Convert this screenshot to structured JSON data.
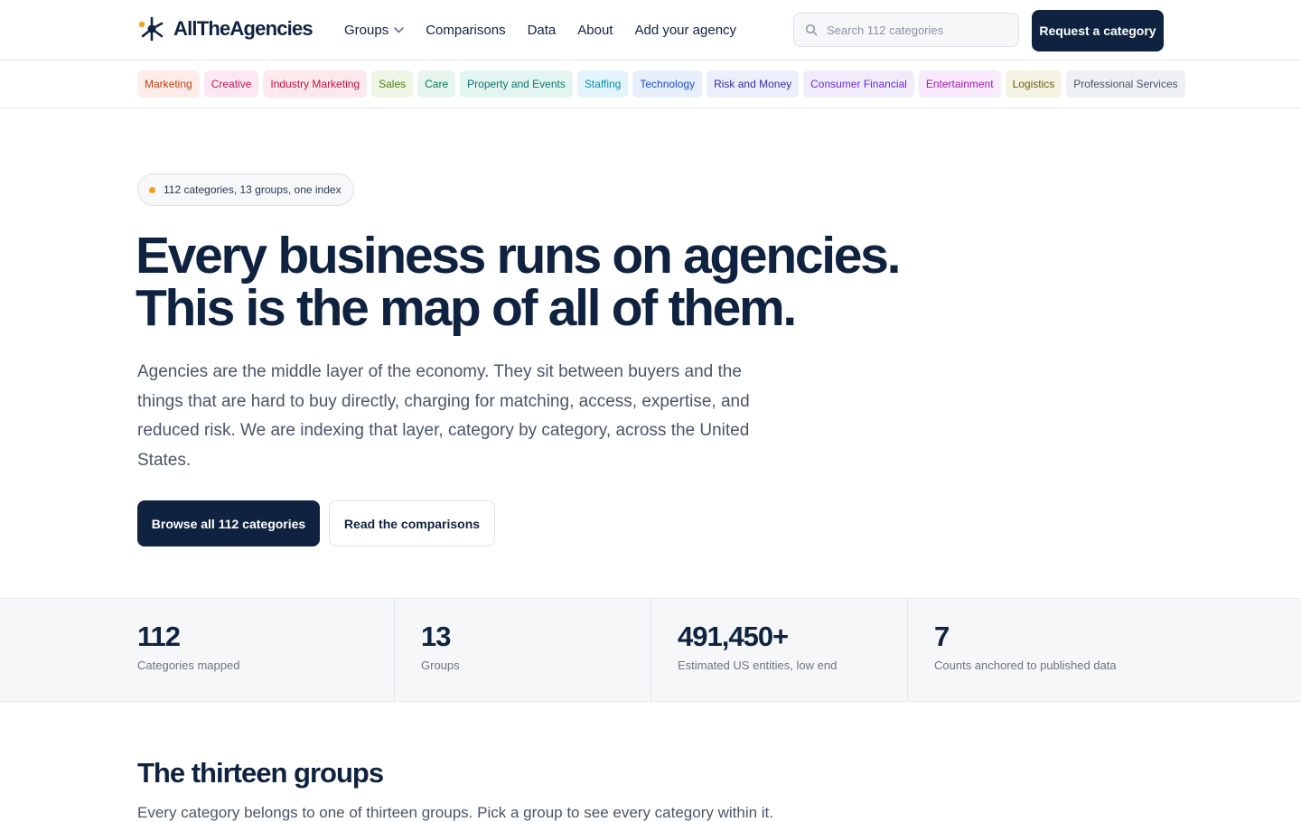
{
  "header": {
    "brand": "AllTheAgencies",
    "nav": [
      {
        "label": "Groups",
        "has_dropdown": true
      },
      {
        "label": "Comparisons"
      },
      {
        "label": "Data"
      },
      {
        "label": "About"
      },
      {
        "label": "Add your agency"
      }
    ],
    "search": {
      "placeholder": "Search 112 categories",
      "value": ""
    },
    "request_button": "Request a category"
  },
  "chips": [
    {
      "label": "Marketing",
      "bg": "#fdecea",
      "fg": "#c2410c"
    },
    {
      "label": "Creative",
      "bg": "#fce8f3",
      "fg": "#be185d"
    },
    {
      "label": "Industry Marketing",
      "bg": "#fde8ee",
      "fg": "#be123c"
    },
    {
      "label": "Sales",
      "bg": "#eef7e6",
      "fg": "#4d7c0f"
    },
    {
      "label": "Care",
      "bg": "#e6f6ee",
      "fg": "#047857"
    },
    {
      "label": "Property and Events",
      "bg": "#e3f5f1",
      "fg": "#0f766e"
    },
    {
      "label": "Staffing",
      "bg": "#e3f4fb",
      "fg": "#0891b2"
    },
    {
      "label": "Technology",
      "bg": "#e6effb",
      "fg": "#1d4ed8"
    },
    {
      "label": "Risk and Money",
      "bg": "#ebeefb",
      "fg": "#3730a3"
    },
    {
      "label": "Consumer Financial",
      "bg": "#f1ecfb",
      "fg": "#6d28d9"
    },
    {
      "label": "Entertainment",
      "bg": "#f8eafa",
      "fg": "#a21caf"
    },
    {
      "label": "Logistics",
      "bg": "#f5f3e2",
      "fg": "#6b5d0f"
    },
    {
      "label": "Professional Services",
      "bg": "#eef0f3",
      "fg": "#475569"
    }
  ],
  "hero": {
    "pill": "112 categories, 13 groups, one index",
    "headline_line1": "Every business runs on agencies.",
    "headline_line2": "This is the map of all of them.",
    "lede": "Agencies are the middle layer of the economy. They sit between buyers and the things that are hard to buy directly, charging for matching, access, expertise, and reduced risk. We are indexing that layer, category by category, across the United States.",
    "primary_cta": "Browse all 112 categories",
    "secondary_cta": "Read the comparisons"
  },
  "stats": [
    {
      "value": "112",
      "label": "Categories mapped"
    },
    {
      "value": "13",
      "label": "Groups"
    },
    {
      "value": "491,450+",
      "label": "Estimated US entities, low end"
    },
    {
      "value": "7",
      "label": "Counts anchored to published data"
    }
  ],
  "groups_section": {
    "title": "The thirteen groups",
    "subtitle": "Every category belongs to one of thirteen groups. Pick a group to see every category within it."
  },
  "colors": {
    "navy": "#0f2340",
    "accent_dot": "#f0a020"
  }
}
